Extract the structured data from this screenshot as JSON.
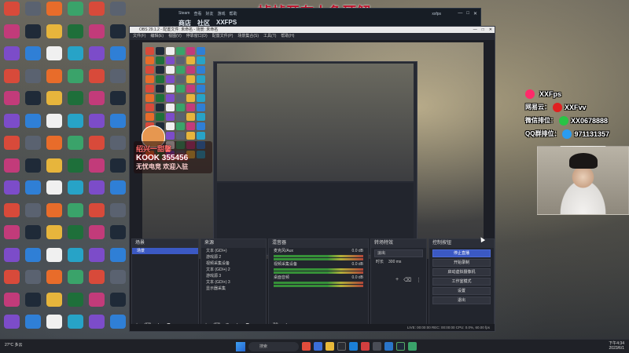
{
  "overlay": {
    "title": "掉帧开在上色硬解",
    "streamer_name": "绍兴一甜馨",
    "kook": "KOOK 355456",
    "tagline": "无忧电竞 欢迎入驻"
  },
  "steam": {
    "menu": [
      "Steam",
      "查看",
      "好友",
      "游戏",
      "帮助"
    ],
    "tabs": [
      "商店",
      "社区",
      "XXFPS"
    ],
    "user": "xxfps",
    "winbtns": [
      "—",
      "□",
      "✕"
    ]
  },
  "obs": {
    "title": "OBS 29.1.2 - 配置文件: 未命名 - 场景: 未命名",
    "menu": [
      "文件(F)",
      "编辑(E)",
      "视图(V)",
      "停靠窗口(D)",
      "配置文件(P)",
      "场景集合(S)",
      "工具(T)",
      "帮助(H)"
    ],
    "winbtns": [
      "—",
      "□",
      "✕"
    ],
    "tabs": [
      "设置",
      "滤镜"
    ],
    "scenes": {
      "header": "场景",
      "items": [
        "场景"
      ]
    },
    "sources": {
      "header": "来源",
      "items": [
        "文本 (GDI+)",
        "游戏源 2",
        "视频采集设备",
        "文本 (GDI+) 2",
        "游戏源 3",
        "文本 (GDI+) 3",
        "显示器采集"
      ]
    },
    "mixer": {
      "header": "混音器",
      "channels": [
        {
          "name": "麦克风/Aux",
          "level": "0.0 dB"
        },
        {
          "name": "视频采集设备",
          "level": "0.0 dB"
        },
        {
          "name": "桌面音频",
          "level": "0.0 dB"
        }
      ]
    },
    "transitions": {
      "header": "转场特效",
      "type": "淡出",
      "duration_label": "时长",
      "duration": "300 ms"
    },
    "controls": {
      "header": "控制按钮",
      "buttons": [
        "停止直播",
        "开始录制",
        "启动虚拟摄像机",
        "工作室模式",
        "设置",
        "退出"
      ]
    },
    "status": "LIVE: 00:00:00   REC: 00:00:00   CPU: 0.0%, 60.00 fps"
  },
  "social": {
    "rows": [
      {
        "label": "",
        "value": "XXFps",
        "icon": "tiktok-icon",
        "color": "#ff2a6a"
      },
      {
        "label": "网易云：",
        "value": "XXFvv",
        "icon": "netease-icon",
        "color": "#e02020"
      },
      {
        "label": "微信排位：",
        "value": "XX0678888",
        "icon": "wechat-icon",
        "color": "#28c445"
      },
      {
        "label": "QQ群排位：",
        "value": "971131357",
        "icon": "qq-icon",
        "color": "#2a9cf0"
      }
    ]
  },
  "taskbar": {
    "weather": "27°C 多云",
    "search_placeholder": "搜索",
    "time": "下午4:34",
    "date": "2023/6/1"
  },
  "colors": {
    "obs_accent": "#3b59c4",
    "title_red": "#c0102a"
  }
}
